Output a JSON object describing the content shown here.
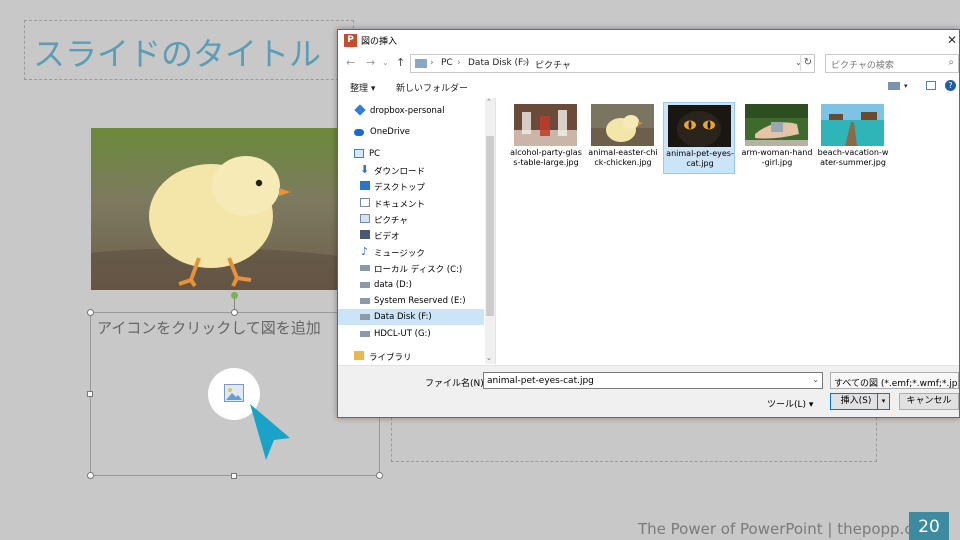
{
  "slide": {
    "title": "スライドのタイトル",
    "placeholder_text": "アイコンをクリックして図を追加",
    "footer": "The Power of PowerPoint | thepopp.com",
    "page_number": "20"
  },
  "dialog": {
    "title": "図の挿入",
    "breadcrumb": [
      "PC",
      "Data Disk (F:)",
      "ピクチャ"
    ],
    "search_placeholder": "ピクチャの検索",
    "toolbar": {
      "organize": "整理 ▾",
      "new_folder": "新しいフォルダー"
    },
    "nav_items": [
      {
        "label": "dropbox-personal",
        "icon": "dropbox-icon"
      },
      {
        "label": "OneDrive",
        "icon": "onedrive-icon"
      },
      {
        "label": "PC",
        "icon": "pc-icon"
      },
      {
        "label": "ダウンロード",
        "icon": "download-icon"
      },
      {
        "label": "デスクトップ",
        "icon": "desktop-icon"
      },
      {
        "label": "ドキュメント",
        "icon": "documents-icon"
      },
      {
        "label": "ピクチャ",
        "icon": "pictures-icon"
      },
      {
        "label": "ビデオ",
        "icon": "video-icon"
      },
      {
        "label": "ミュージック",
        "icon": "music-icon"
      },
      {
        "label": "ローカル ディスク (C:)",
        "icon": "drive-icon"
      },
      {
        "label": "data (D:)",
        "icon": "drive-icon"
      },
      {
        "label": "System Reserved (E:)",
        "icon": "drive-icon"
      },
      {
        "label": "Data Disk (F:)",
        "icon": "drive-icon",
        "selected": true
      },
      {
        "label": "HDCL-UT (G:)",
        "icon": "drive-icon"
      },
      {
        "label": "ライブラリ",
        "icon": "library-icon"
      }
    ],
    "files": [
      {
        "name": "alcohol-party-glass-table-large.jpg"
      },
      {
        "name": "animal-easter-chick-chicken.jpg"
      },
      {
        "name": "animal-pet-eyes-cat.jpg",
        "selected": true
      },
      {
        "name": "arm-woman-hand-girl.jpg"
      },
      {
        "name": "beach-vacation-water-summer.jpg"
      }
    ],
    "filename_label": "ファイル名(N):",
    "filename_value": "animal-pet-eyes-cat.jpg",
    "filetype_value": "すべての図 (*.emf;*.wmf;*.jpg",
    "tools_label": "ツール(L)",
    "insert_label": "挿入(S)",
    "cancel_label": "キャンセル"
  },
  "colors": {
    "accent": "#3d8ba0",
    "title": "#5b9db6",
    "selection": "#cce4f7"
  }
}
